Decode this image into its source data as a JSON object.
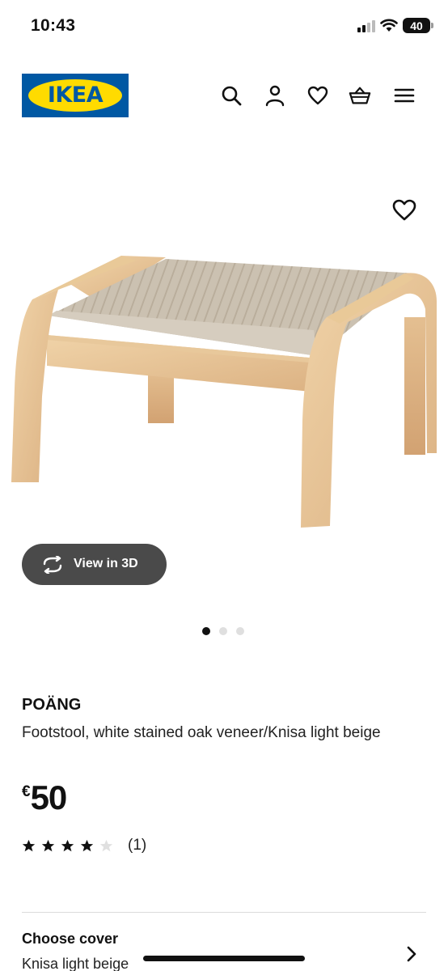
{
  "status_bar": {
    "time": "10:43",
    "battery": "40"
  },
  "header": {
    "logo_text": "IKEA",
    "icons": [
      "search-icon",
      "user-icon",
      "heart-icon",
      "basket-icon",
      "menu-icon"
    ]
  },
  "gallery": {
    "view_3d_label": "View in 3D",
    "image_count": 3,
    "active_index": 0
  },
  "product": {
    "name": "POÄNG",
    "description": "Footstool, white stained oak veneer/Knisa light beige",
    "currency": "€",
    "price": "50",
    "rating": 4,
    "rating_max": 5,
    "review_count": "(1)"
  },
  "cover": {
    "title": "Choose cover",
    "value": "Knisa light beige"
  },
  "colors": {
    "ikea_blue": "#0058A3",
    "ikea_yellow": "#FFDB00",
    "button_dark": "#4a4a4a"
  }
}
